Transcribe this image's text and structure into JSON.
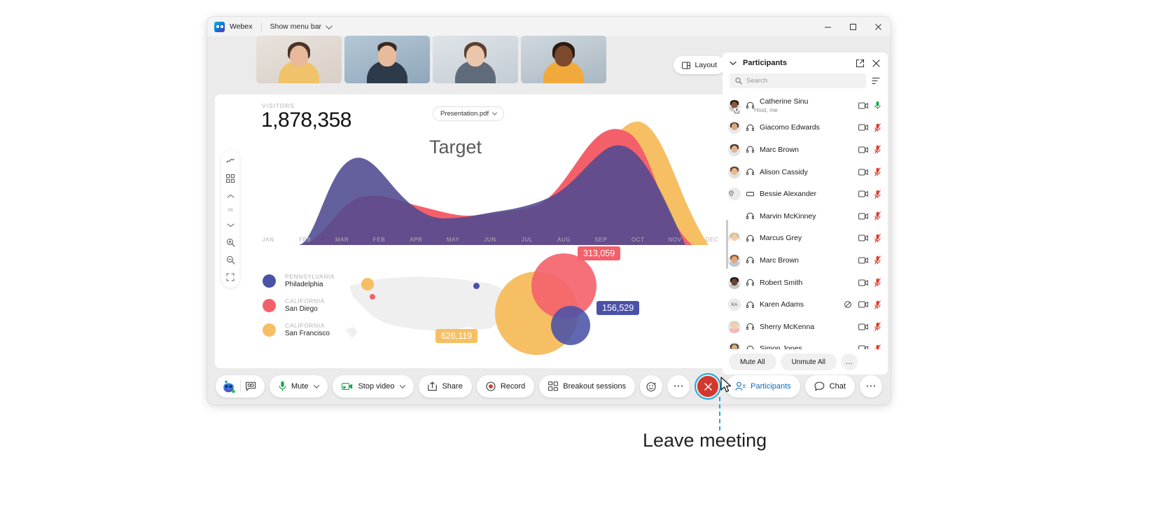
{
  "window": {
    "app_name": "Webex",
    "menu_bar_label": "Show menu bar",
    "controls": {
      "minimize": "minimize",
      "maximize": "maximize",
      "close": "close"
    }
  },
  "layout_button": {
    "label": "Layout"
  },
  "slide": {
    "metric_label": "VISITORS",
    "metric_value": "1,878,358",
    "file_chip": "Presentation.pdf",
    "title": "Target",
    "page_indicator": "03",
    "legend": [
      {
        "state": "PENNSYLVANIA",
        "city": "Philadelphia",
        "color": "#4a52a8"
      },
      {
        "state": "CALIFORNIA",
        "city": "San Diego",
        "color": "#f4606a"
      },
      {
        "state": "CALIFORNIA",
        "city": "San Francisco",
        "color": "#f7bf63"
      }
    ],
    "bubbles": [
      {
        "value": "313,059",
        "color": "#f4606a"
      },
      {
        "value": "156,529",
        "color": "#4a52a8"
      },
      {
        "value": "626,119",
        "color": "#f7bf63"
      }
    ]
  },
  "chart_data": {
    "type": "area",
    "title": "Target",
    "xlabel": "",
    "ylabel": "Visitors",
    "categories": [
      "JAN",
      "FEB",
      "MAR",
      "FEB",
      "APR",
      "MAY",
      "JUN",
      "JUL",
      "AUG",
      "SEP",
      "OCT",
      "NOV",
      "DEC"
    ],
    "series": [
      {
        "name": "Philadelphia",
        "color": "#4a52a8",
        "values": [
          5,
          62,
          40,
          30,
          28,
          26,
          30,
          34,
          46,
          72,
          92,
          66,
          6
        ]
      },
      {
        "name": "San Diego",
        "color": "#f4606a",
        "values": [
          0,
          12,
          36,
          30,
          26,
          24,
          25,
          27,
          38,
          82,
          74,
          40,
          0
        ]
      },
      {
        "name": "San Francisco",
        "color": "#f7bf63",
        "values": [
          0,
          6,
          26,
          24,
          22,
          21,
          22,
          25,
          33,
          60,
          96,
          78,
          0
        ]
      }
    ],
    "ylim": [
      0,
      100
    ],
    "grid": false,
    "legend_position": "bottom-left"
  },
  "bubble_chart": {
    "type": "scatter",
    "points": [
      {
        "label": "626,119",
        "color": "#f7bf63",
        "size": 119
      },
      {
        "label": "313,059",
        "color": "#f4606a",
        "size": 93
      },
      {
        "label": "156,529",
        "color": "#4a52a8",
        "size": 56
      }
    ]
  },
  "panel": {
    "title": "Participants",
    "search_placeholder": "Search",
    "search_value": "",
    "mute_all_label": "Mute All",
    "unmute_all_label": "Unmute All",
    "more_label": "…",
    "participants": [
      {
        "name": "Catherine Sinu",
        "role": "Host, me",
        "avatar": "photo",
        "skin": "#8a5a3b",
        "hair": "#20150f",
        "body": "#d8c8bc",
        "device": "headset",
        "camera": true,
        "mic_state": "on",
        "sharing": true
      },
      {
        "name": "Giacomo Edwards",
        "role": "",
        "avatar": "photo",
        "skin": "#d9a97f",
        "hair": "#2e2017",
        "body": "#e6e9ec",
        "device": "headset",
        "camera": true,
        "mic_state": "muted"
      },
      {
        "name": "Marc Brown",
        "role": "",
        "avatar": "photo",
        "skin": "#e2b48c",
        "hair": "#4a3326",
        "body": "#dfe6ee",
        "device": "headset",
        "camera": true,
        "mic_state": "muted"
      },
      {
        "name": "Alison Cassidy",
        "role": "",
        "avatar": "photo",
        "skin": "#e6b893",
        "hair": "#6b3b22",
        "body": "#e8dfd6",
        "device": "headset",
        "camera": true,
        "mic_state": "muted"
      },
      {
        "name": "Bessie Alexander",
        "role": "",
        "avatar": "pin",
        "device": "device",
        "camera": true,
        "mic_state": "muted"
      },
      {
        "name": "Marvin McKinney",
        "role": "",
        "avatar": "none",
        "device": "headset",
        "camera": true,
        "mic_state": "muted"
      },
      {
        "name": "Marcus Grey",
        "role": "",
        "avatar": "photo",
        "skin": "#f0cdaa",
        "hair": "#d8b25f",
        "body": "#ffffff",
        "device": "headset",
        "camera": true,
        "mic_state": "muted"
      },
      {
        "name": "Marc Brown",
        "role": "",
        "avatar": "photo",
        "skin": "#e0a87c",
        "hair": "#8a5a33",
        "body": "#b9c9d8",
        "device": "headset",
        "camera": true,
        "mic_state": "muted"
      },
      {
        "name": "Robert Smith",
        "role": "",
        "avatar": "photo",
        "skin": "#6b4430",
        "hair": "#1d130d",
        "body": "#c9c9c9",
        "device": "headset",
        "camera": true,
        "mic_state": "muted"
      },
      {
        "name": "Karen Adams",
        "role": "",
        "avatar": "initials",
        "initials": "KA",
        "device": "headset",
        "camera": true,
        "mic_state": "muted",
        "extra_icon": "no-video"
      },
      {
        "name": "Sherry McKenna",
        "role": "",
        "avatar": "photo",
        "skin": "#f1d0b4",
        "hair": "#e3cf9f",
        "body": "#f2b8ba",
        "device": "headset",
        "camera": true,
        "mic_state": "muted"
      },
      {
        "name": "Simon Jones",
        "role": "",
        "avatar": "photo",
        "skin": "#d9a97f",
        "hair": "#3a2a1c",
        "body": "#aec6dd",
        "device": "headset",
        "camera": true,
        "mic_state": "muted"
      }
    ]
  },
  "controlbar": {
    "captions_label": "captions",
    "mute_label": "Mute",
    "video_label": "Stop video",
    "share_label": "Share",
    "record_label": "Record",
    "breakout_label": "Breakout sessions",
    "reactions_label": "reactions",
    "more_label": "⋯",
    "leave_label": "leave",
    "participants_label": "Participants",
    "chat_label": "Chat",
    "overflow_label": "⋯"
  },
  "callout": {
    "text": "Leave meeting",
    "accent_color": "#1aa9e0"
  }
}
